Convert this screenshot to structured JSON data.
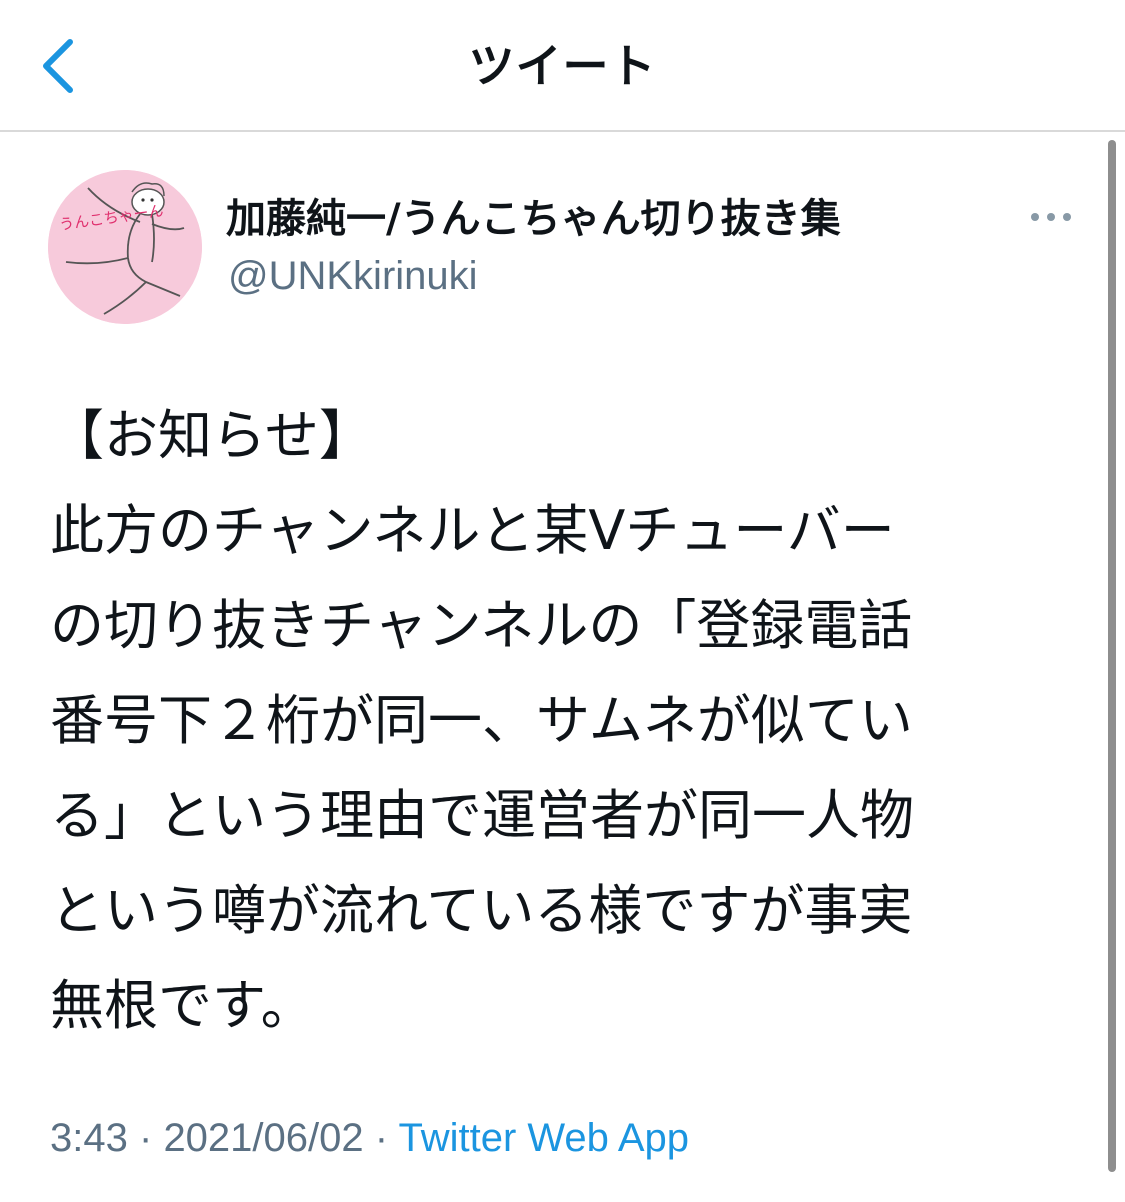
{
  "nav": {
    "back_icon": "chevron-left-icon",
    "title": "ツイート"
  },
  "colors": {
    "accent": "#1b95e0",
    "secondary_text": "#5b7083",
    "primary_text": "#0f1419",
    "avatar_bg": "#f7cadb"
  },
  "tweet": {
    "author": {
      "display_name": "加藤純一/うんこちゃん切り抜き集",
      "handle": "@UNKkirinuki",
      "avatar_text": "うんこちゃーん"
    },
    "more_icon": "more-horizontal-icon",
    "text_lines": [
      "【お知らせ】",
      "此方のチャンネルと某Vチューバー",
      "の切り抜きチャンネルの「登録電話",
      "番号下２桁が同一、サムネが似てい",
      "る」という理由で運営者が同一人物",
      "という噂が流れている様ですが事実",
      "無根です。"
    ],
    "time": "3:43",
    "date": "2021/06/02",
    "separator": "·",
    "source": "Twitter Web App"
  }
}
